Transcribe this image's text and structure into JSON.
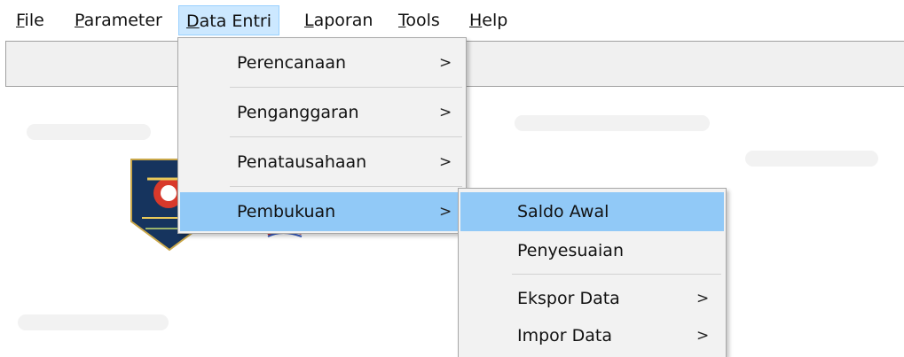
{
  "menubar": {
    "items": [
      {
        "mnemonic": "F",
        "rest": "ile"
      },
      {
        "mnemonic": "P",
        "rest": "arameter"
      },
      {
        "mnemonic": "D",
        "rest": "ata Entri"
      },
      {
        "mnemonic": "L",
        "rest": "aporan"
      },
      {
        "mnemonic": "T",
        "rest": "ools"
      },
      {
        "mnemonic": "H",
        "rest": "elp"
      }
    ]
  },
  "data_entri_menu": {
    "items": [
      {
        "label": "Perencanaan",
        "arrow": ">"
      },
      {
        "label": "Penganggaran",
        "arrow": ">"
      },
      {
        "label": "Penatausahaan",
        "arrow": ">"
      },
      {
        "label": "Pembukuan",
        "arrow": ">"
      }
    ]
  },
  "pembukuan_menu": {
    "items": [
      {
        "label": "Saldo Awal"
      },
      {
        "label": "Penyesuaian"
      },
      {
        "label": "Ekspor Data",
        "arrow": ">"
      },
      {
        "label": "Impor Data",
        "arrow": ">"
      }
    ]
  },
  "colors": {
    "menu_active": "#cce8ff",
    "menu_highlight": "#91c9f7",
    "menu_bg": "#f2f2f2",
    "toolbar_bg": "#f0f0f0"
  },
  "icons": {
    "emblem": "government-emblem-icon",
    "submenu": "chevron-right-icon"
  }
}
